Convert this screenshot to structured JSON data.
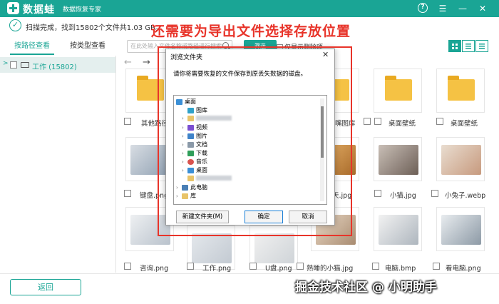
{
  "app": {
    "name": "数据蛙",
    "subtitle": "数据恢复专家",
    "help_label": "?"
  },
  "status": {
    "text": "扫描完成，找到15802个文件共1.03 GB。"
  },
  "annotation": "还需要为导出文件选择存放位置",
  "tabs": {
    "by_path": "按路径查看",
    "by_type": "按类型查看"
  },
  "search": {
    "placeholder": "在此处输入文件名称或路径进行搜索",
    "filter_label": "筛选"
  },
  "only_deleted_label": "仅显示删除项",
  "tree": {
    "root_label": "工作 (15802)"
  },
  "files": [
    {
      "name": "其他路径"
    },
    {
      "name": ""
    },
    {
      "name": ""
    },
    {
      "name": ""
    },
    {
      "name": "嘴图库"
    },
    {
      "name": "桌面壁纸"
    },
    {
      "name": "桌面壁纸"
    },
    {
      "name": "键盘.png"
    },
    {
      "name": ""
    },
    {
      "name": ""
    },
    {
      "name": ""
    },
    {
      "name": "天.jpg"
    },
    {
      "name": "小猫.jpg"
    },
    {
      "name": "小兔子.webp"
    },
    {
      "name": "咨询.png"
    },
    {
      "name": "工作.png"
    },
    {
      "name": "U盘.png"
    },
    {
      "name": "熟睡的小猫.jpg"
    },
    {
      "name": "电脑.bmp"
    },
    {
      "name": "看电脑.png"
    }
  ],
  "dialog": {
    "title": "浏览文件夹",
    "description": "请你将需要恢复的文件保存到原丢失数据的磁盘。",
    "close": "✕",
    "tree": [
      {
        "label": "桌面",
        "icon": "desktop-icon"
      },
      {
        "label": "图库",
        "icon": "gallery-icon"
      },
      {
        "label": "",
        "icon": "user-folder-icon"
      },
      {
        "label": "视频",
        "icon": "video-icon"
      },
      {
        "label": "图片",
        "icon": "picture-icon"
      },
      {
        "label": "文档",
        "icon": "document-icon"
      },
      {
        "label": "下载",
        "icon": "download-icon"
      },
      {
        "label": "音乐",
        "icon": "music-icon"
      },
      {
        "label": "桌面",
        "icon": "desktop-icon"
      },
      {
        "label": "",
        "icon": "folder-icon"
      },
      {
        "label": "此电脑",
        "icon": "computer-icon"
      },
      {
        "label": "库",
        "icon": "library-icon"
      }
    ],
    "new_folder_label": "新建文件夹(M)",
    "ok_label": "确定",
    "cancel_label": "取消"
  },
  "back_label": "返回",
  "watermark": "掘金技术社区 @ 小明助手",
  "colors": {
    "accent": "#1aa595",
    "annotation_red": "#e8342a",
    "folder_yellow": "#f5c244"
  }
}
